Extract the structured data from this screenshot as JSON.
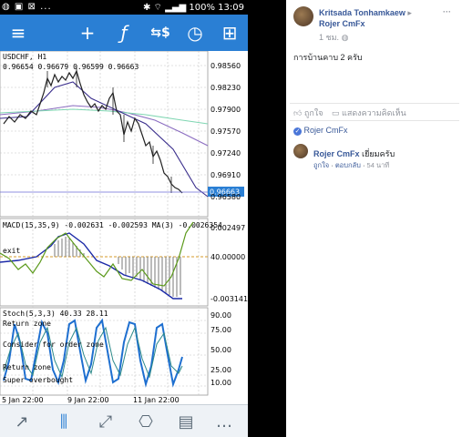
{
  "status_bar": {
    "left": "◍ ▣ ⊠ ...",
    "right": "⌖ 100% 13:09",
    "battery": "100%",
    "time": "13:09"
  },
  "toolbar": {
    "items": [
      {
        "name": "menu-icon",
        "glyph": "≡"
      },
      {
        "name": "crosshair-icon",
        "glyph": "+"
      },
      {
        "name": "indicator-icon",
        "glyph": "ƒ"
      },
      {
        "name": "trade-icon",
        "glyph": "⇆$"
      },
      {
        "name": "clock-icon",
        "glyph": "◷"
      },
      {
        "name": "add-icon",
        "glyph": "⊞"
      }
    ]
  },
  "chart": {
    "symbol": "USDCHF, H1",
    "ohlc": "0.96654 0.96679 0.96599 0.96663",
    "price_ticks": [
      "0.98560",
      "0.98230",
      "0.97900",
      "0.97570",
      "0.97240",
      "0.96910",
      "0.96580"
    ],
    "current_price": "0.96663",
    "accent": "#2a7fd4",
    "macd_header": "MACD(15,35,9) -0.002631 -0.002593 MA(3) -0.0026354",
    "macd_ticks": [
      "0.002497",
      "40.00000",
      "-0.003141"
    ],
    "macd_label": "exit",
    "stoch_header": "Stoch(5,3,3) 40.33 28.11",
    "stoch_ticks": [
      "90.00",
      "75.00",
      "50.00",
      "25.00",
      "10.00"
    ],
    "stoch_notes": [
      "Return zone",
      "Consider for order zone",
      "Return zone",
      "Super overbought"
    ],
    "time_labels": [
      "5 Jan 22:00",
      "9 Jan 22:00",
      "11 Jan 22:00"
    ]
  },
  "bottom_bar": {
    "items": [
      {
        "name": "trend-line-icon",
        "glyph": "↗"
      },
      {
        "name": "candles-icon",
        "glyph": "⫼"
      },
      {
        "name": "tools-icon",
        "glyph": "⤢"
      },
      {
        "name": "inbox-icon",
        "glyph": "⎔"
      },
      {
        "name": "news-icon",
        "glyph": "▤"
      },
      {
        "name": "chat-icon",
        "glyph": "…"
      }
    ]
  },
  "facebook": {
    "author": "Kritsada Tonhamkaew",
    "arrow": "▸",
    "recipient": "Rojer CmFx",
    "time": "1 ชม.",
    "more": "···",
    "post_text": "การบ้านคาบ 2 ครับ",
    "like_label": "ถูกใจ",
    "comment_label": "แสดงความคิดเห็น",
    "liker": "Rojer CmFx",
    "comment": {
      "author": "Rojer CmFx",
      "text": "เยี่ยมครับ",
      "like": "ถูกใจ",
      "reply": "ตอบกลับ",
      "time": "54 นาที"
    }
  }
}
